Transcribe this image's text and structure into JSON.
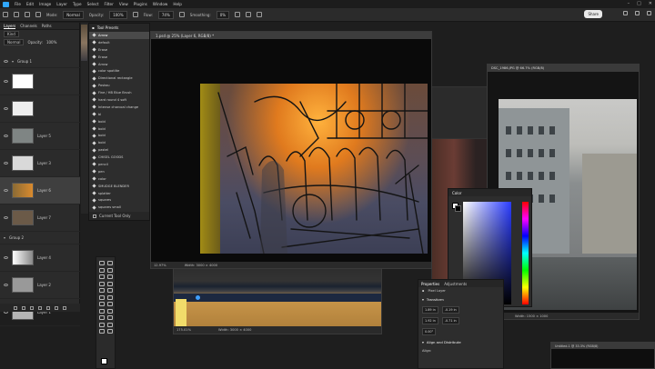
{
  "menubar": {
    "items": [
      "File",
      "Edit",
      "Image",
      "Layer",
      "Type",
      "Select",
      "Filter",
      "View",
      "Plugins",
      "Window",
      "Help"
    ]
  },
  "options_bar": {
    "mode_label": "Mode:",
    "mode_value": "Normal",
    "opacity_label": "Opacity:",
    "opacity_value": "100%",
    "flow_label": "Flow:",
    "flow_value": "74%",
    "smoothing_label": "Smoothing:",
    "smoothing_value": "0%",
    "share_label": "Share"
  },
  "layers_panel": {
    "tabs": [
      "Layers",
      "Channels",
      "Paths"
    ],
    "search_placeholder": "Kind",
    "blend_mode": "Normal",
    "opacity_label": "Opacity:",
    "opacity_value": "100%",
    "lock_label": "Lock:",
    "fill_label": "Fill:",
    "fill_value": "100%",
    "group1": "Group 1",
    "group2": "Group 2",
    "layers": [
      {
        "name": "Layer 5"
      },
      {
        "name": "Layer 3"
      },
      {
        "name": "Layer 6"
      },
      {
        "name": "Layer 7"
      },
      {
        "name": "Layer 4"
      },
      {
        "name": "Layer 2"
      },
      {
        "name": "Layer 1"
      }
    ]
  },
  "tool_presets": {
    "title": "Tool Presets",
    "items": [
      "Arrow",
      "default",
      "Erase",
      "Erase",
      "Arrow",
      "color spotlite",
      "Directional rectangle",
      "Poskou",
      "Fine / HB Blue Brush",
      "hard round 4 soft",
      "Intense charcoal change",
      "bl",
      "bold",
      "bold",
      "bold",
      "bold",
      "pastel",
      "CHISEL GOODS",
      "pencil",
      "pen",
      "color",
      "SMUDGE BLENDER",
      "splatter",
      "squares",
      "squares small",
      "bellows"
    ],
    "selected_index": 0,
    "footer_label": "Current Tool Only"
  },
  "main_doc": {
    "tab": "1.psd @ 25% (Layer 6, RGB/8) *",
    "zoom": "12.97%",
    "status": "Width: 3000 × 4000"
  },
  "photo_doc": {
    "tab": "DSC_1986.JPG @ 66.7% (RGB/8)",
    "status": "Width: 1500 × 1000"
  },
  "second_doc": {
    "zoom": "175.01%",
    "status": "Width: 3000 × 4000"
  },
  "small_doc": {
    "tab": "Untitled-1 @ 33.3% (RGB/8)"
  },
  "color_panel": {
    "title": "Color"
  },
  "properties_panel": {
    "tabs": [
      "Properties",
      "Adjustments"
    ],
    "kind_label": "Pixel Layer",
    "transform_label": "Transform",
    "w_value": "1.89 in",
    "x_value": "-0.19 in",
    "h_value": "1.92 in",
    "y_value": "-0.71 in",
    "angle_value": "0.00°",
    "align_label": "Align and Distribute",
    "align_sub": "Align:"
  },
  "colors": {
    "ps_blue": "#31a8ff",
    "panel_bg": "#2d2d2d",
    "app_bg": "#1e1e1e"
  }
}
